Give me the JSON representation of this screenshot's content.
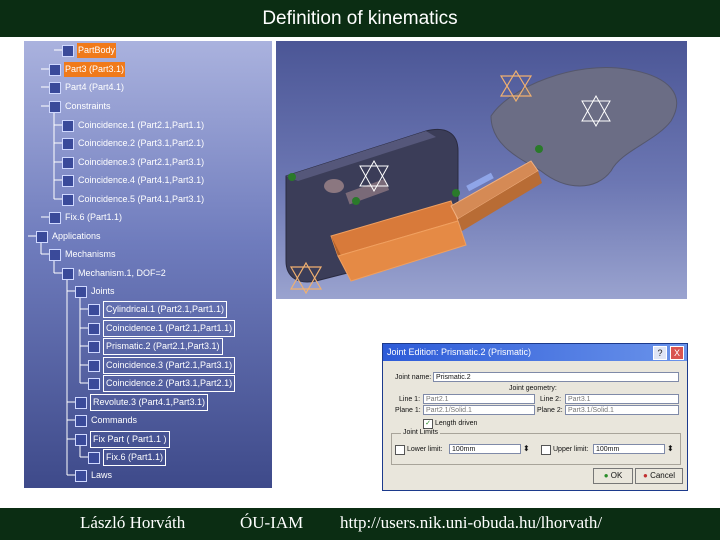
{
  "title": "Definition of kinematics",
  "tree": {
    "items": [
      {
        "label": "PartBody",
        "sel": true
      },
      {
        "label": "Part3 (Part3.1)",
        "sel": true
      },
      {
        "label": "Part4 (Part4.1)"
      },
      {
        "label": "Constraints"
      },
      {
        "label": "Coincidence.1 (Part2.1,Part1.1)"
      },
      {
        "label": "Coincidence.2 (Part3.1,Part2.1)"
      },
      {
        "label": "Coincidence.3 (Part2.1,Part3.1)"
      },
      {
        "label": "Coincidence.4 (Part4.1,Part3.1)"
      },
      {
        "label": "Coincidence.5 (Part4.1,Part3.1)"
      },
      {
        "label": "Fix.6 (Part1.1)"
      },
      {
        "label": "Applications"
      },
      {
        "label": "Mechanisms"
      },
      {
        "label": "Mechanism.1, DOF=2"
      },
      {
        "label": "Joints"
      },
      {
        "label": "Cylindrical.1 (Part2.1,Part1.1)",
        "box": true
      },
      {
        "label": "Coincidence.1 (Part2.1,Part1.1)",
        "box": true
      },
      {
        "label": "Prismatic.2 (Part2.1,Part3.1)",
        "box": true
      },
      {
        "label": "Coincidence.3 (Part2.1,Part3.1)",
        "box": true
      },
      {
        "label": "Coincidence.2 (Part3.1,Part2.1)",
        "box": true
      },
      {
        "label": "Revolute.3 (Part4.1,Part3.1)",
        "box": true
      },
      {
        "label": "Commands"
      },
      {
        "label": "Fix Part ( Part1.1 )",
        "box": true
      },
      {
        "label": "Fix.6 (Part1.1)",
        "box": true
      },
      {
        "label": "Laws"
      }
    ]
  },
  "dialog": {
    "title": "Joint Edition: Prismatic.2 (Prismatic)",
    "help_label": "?",
    "close_label": "X",
    "joint_name_label": "Joint name:",
    "joint_name_value": "Prismatic.2",
    "joint_geometry_label": "Joint geometry:",
    "line1_label": "Line 1:",
    "line1_value": "Part2.1",
    "line2_label": "Line 2:",
    "line2_value": "Part3.1",
    "plane1_label": "Plane 1:",
    "plane1_value": "Part2.1/Solid.1",
    "plane2_label": "Plane 2:",
    "plane2_value": "Part3.1/Solid.1",
    "length_driven_label": "Length driven",
    "joint_limits_label": "Joint Limits",
    "lower_limit_label": "Lower limit:",
    "lower_limit_value": "100mm",
    "upper_limit_label": "Upper limit:",
    "upper_limit_value": "100mm",
    "ok_label": "OK",
    "cancel_label": "Cancel"
  },
  "footer": {
    "author": "László Horváth",
    "institution": "ÓU-IAM",
    "url": "http://users.nik.uni-obuda.hu/lhorvath/"
  },
  "colors": {
    "title_bar": "#0b2d13",
    "selection": "#f07a1a",
    "dialog_title": "#2d5bd8"
  }
}
